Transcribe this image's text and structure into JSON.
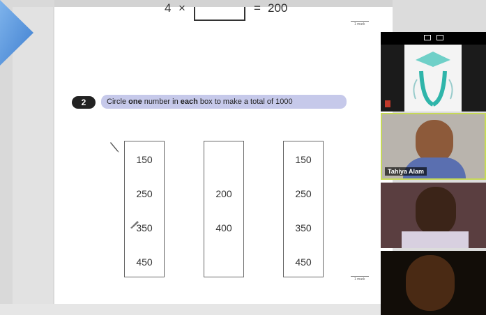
{
  "question1": {
    "left_operand": "4",
    "operator": "×",
    "equals": "=",
    "result": "200",
    "mark_label": "1 mark"
  },
  "question2": {
    "number": "2",
    "instruction_pre": "Circle ",
    "instruction_bold1": "one",
    "instruction_mid": " number in ",
    "instruction_bold2": "each",
    "instruction_post": " box to make a total of 1000",
    "boxes": [
      [
        "150",
        "250",
        "350",
        "450"
      ],
      [
        "200",
        "400"
      ],
      [
        "150",
        "250",
        "350",
        "450"
      ]
    ],
    "mark_label": "1 mark"
  },
  "video": {
    "participant2_name": "Tahiya Alam"
  },
  "colors": {
    "instruction_bar": "#c6c9ea",
    "arrow": "#4a8fd6",
    "active_speaker_border": "#c6d957"
  },
  "icons": [
    "right-arrow-icon",
    "pencil-icon",
    "minimize-icon",
    "popout-icon",
    "mic-muted-icon"
  ]
}
